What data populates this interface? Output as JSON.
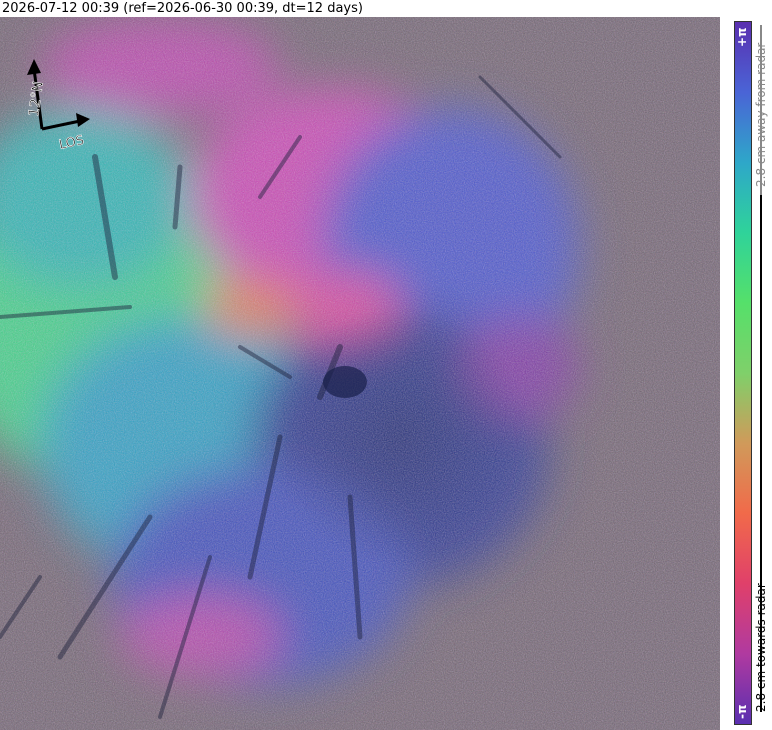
{
  "header": {
    "title": "2026-07-12 00:39 (ref=2026-06-30 00:39, dt=12 days)"
  },
  "compass": {
    "north_label": "12°N",
    "los_label": "LOS"
  },
  "colorbar": {
    "top_label": "+π",
    "bottom_label": "-π",
    "away_label": "2.8 cm away from radar",
    "towards_label": "2.8 cm towards radar",
    "colors": [
      "#5a2fb0",
      "#4a64d6",
      "#2ea7c9",
      "#2fd39a",
      "#55e06a",
      "#7fd06a",
      "#d09a5a",
      "#f16a4a",
      "#e0406a",
      "#b03aa0",
      "#5a2fb0"
    ]
  },
  "scene_colors": {
    "blue": "#3a55c6",
    "magenta": "#c84ab0",
    "teal": "#2fa4b0",
    "green": "#47d07a",
    "dark": "#2a3a8a",
    "noise": "#7a6a6a"
  }
}
